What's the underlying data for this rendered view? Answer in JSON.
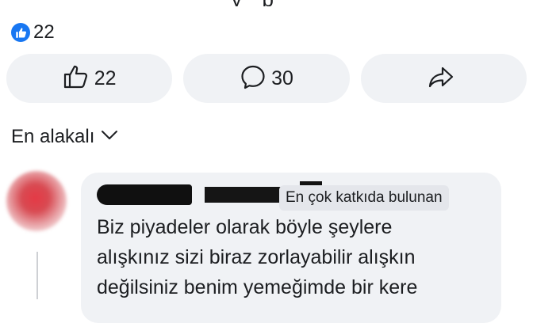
{
  "post": {
    "reaction_count": "22"
  },
  "actions": [
    {
      "icon": "thumbs-up-icon",
      "label": "22"
    },
    {
      "icon": "comment-icon",
      "label": "30"
    },
    {
      "icon": "share-icon",
      "label": ""
    }
  ],
  "comments_sort": {
    "label": "En alakalı"
  },
  "comment": {
    "badge": "En çok katkıda bulunan",
    "text": "Biz piyadeler olarak böyle şeylere\nalışkınız sizi biraz zorlayabilir alışkın\ndeğilsiniz benim yemeğimde bir kere"
  },
  "colors": {
    "accent": "#1877f2",
    "button_bg": "#f0f2f5",
    "bubble_bg": "#f0f2f5",
    "badge_bg": "#e4e6eb",
    "text": "#1c1e21"
  }
}
